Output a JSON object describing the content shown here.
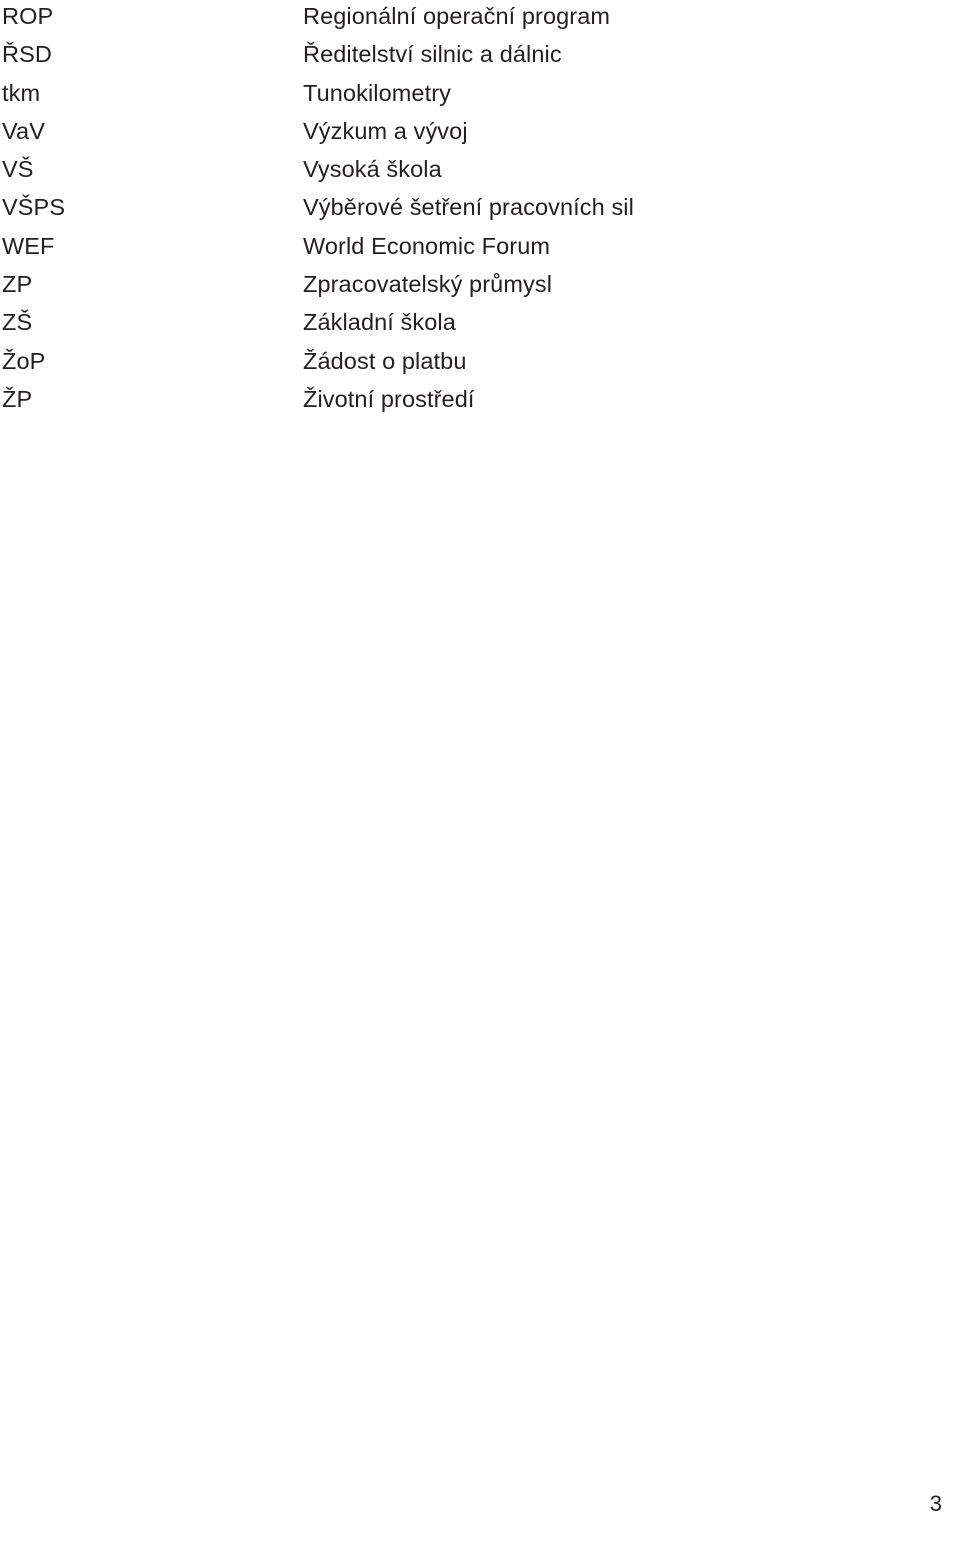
{
  "document": {
    "language": "cs",
    "background_color": "#ffffff",
    "text_color": "#231f20"
  },
  "glossary": {
    "rows": [
      {
        "term": "ROP",
        "definition": "Regionální operační program"
      },
      {
        "term": "ŘSD",
        "definition": "Ředitelství silnic a dálnic"
      },
      {
        "term": "tkm",
        "definition": "Tunokilometry"
      },
      {
        "term": "VaV",
        "definition": "Výzkum a vývoj"
      },
      {
        "term": "VŠ",
        "definition": "Vysoká škola"
      },
      {
        "term": "VŠPS",
        "definition": "Výběrové šetření pracovních sil"
      },
      {
        "term": "WEF",
        "definition": "World Economic Forum"
      },
      {
        "term": "ZP",
        "definition": "Zpracovatelský průmysl"
      },
      {
        "term": "ZŠ",
        "definition": "Základní škola"
      },
      {
        "term": "ŽoP",
        "definition": "Žádost o platbu"
      },
      {
        "term": "ŽP",
        "definition": "Životní prostředí"
      }
    ]
  },
  "footer": {
    "page_number": "3"
  }
}
